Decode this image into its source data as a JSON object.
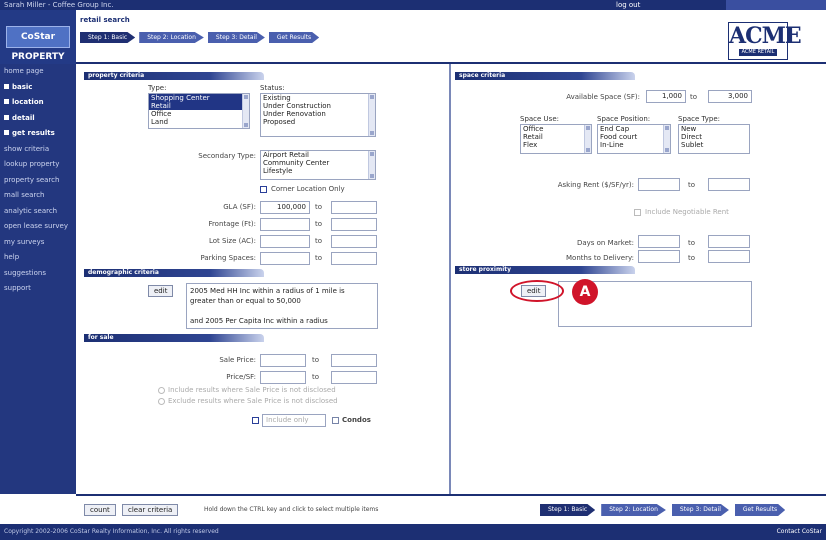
{
  "top": {
    "title": "Sarah Miller - Coffee Group Inc.",
    "logout": "log out"
  },
  "logo": "CoStar PROPERTY",
  "header": {
    "title": "retail search",
    "steps": [
      "Step 1: Basic",
      "Step 2: Location",
      "Step 3: Detail",
      "Get Results"
    ]
  },
  "brand": {
    "name": "ACME",
    "tagline": "ACME RETAIL"
  },
  "sidebar": [
    {
      "label": "home page"
    },
    {
      "label": "basic",
      "active": true
    },
    {
      "label": "location",
      "active": true
    },
    {
      "label": "detail",
      "active": true
    },
    {
      "label": "get results",
      "active": true
    },
    {
      "label": "show criteria"
    },
    {
      "label": "lookup property"
    },
    {
      "label": "property search"
    },
    {
      "label": "mall search"
    },
    {
      "label": "analytic search"
    },
    {
      "label": "open lease survey"
    },
    {
      "label": "my surveys"
    },
    {
      "label": "help"
    },
    {
      "label": "suggestions"
    },
    {
      "label": "support"
    }
  ],
  "property": {
    "section": "property criteria",
    "type_label": "Type:",
    "type_options": [
      "Shopping Center",
      "Retail",
      "Office",
      "Land"
    ],
    "status_label": "Status:",
    "status_options": [
      "Existing",
      "Under Construction",
      "Under Renovation",
      "Proposed"
    ],
    "secondary_label": "Secondary Type:",
    "secondary_options": [
      "Airport Retail",
      "Community Center",
      "Lifestyle"
    ],
    "corner_label": "Corner Location Only",
    "gla_label": "GLA (SF):",
    "gla_from": "100,000",
    "frontage_label": "Frontage (Ft):",
    "lotsize_label": "Lot Size (AC):",
    "parking_label": "Parking Spaces:",
    "to": "to"
  },
  "demographic": {
    "section": "demographic criteria",
    "edit": "edit",
    "text": "2005 Med HH Inc within a radius of 1 mile is greater than or equal to 50,000\n\nand 2005 Per Capita Inc within a radius"
  },
  "sale": {
    "section": "for sale",
    "price_label": "Sale Price:",
    "pricesf_label": "Price/SF:",
    "opt1": "Include results where Sale Price is not disclosed",
    "opt2": "Exclude results where Sale Price is not disclosed",
    "include_only": "Include only",
    "condos": "Condos"
  },
  "space": {
    "section": "space criteria",
    "available_label": "Available Space (SF):",
    "available_from": "1,000",
    "available_to": "3,000",
    "use_label": "Space Use:",
    "use_options": [
      "Office",
      "Retail",
      "Flex"
    ],
    "position_label": "Space Position:",
    "position_options": [
      "End Cap",
      "Food court",
      "In-Line"
    ],
    "type_label": "Space Type:",
    "type_options": [
      "New",
      "Direct",
      "Sublet"
    ],
    "rent_label": "Asking Rent ($/SF/yr):",
    "negotiable": "Include Negotiable Rent",
    "days_label": "Days on Market:",
    "months_label": "Months to Delivery:",
    "to": "to"
  },
  "proximity": {
    "section": "store proximity",
    "edit": "edit",
    "callout": "A"
  },
  "footer": {
    "count": "count",
    "clear": "clear criteria",
    "hint": "Hold down the CTRL key and click to select multiple items",
    "steps": [
      "Step 1: Basic",
      "Step 2: Location",
      "Step 3: Detail",
      "Get Results"
    ]
  },
  "copyright": {
    "text": "Copyright 2002-2006 CoStar Realty Information, Inc. All rights reserved",
    "contact": "Contact CoStar"
  }
}
